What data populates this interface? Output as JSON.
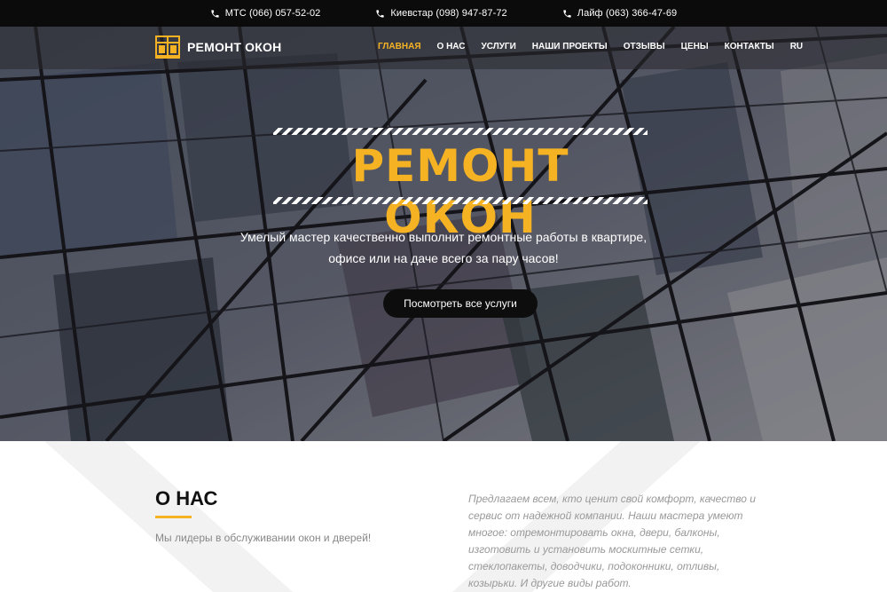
{
  "topbar": {
    "phones": [
      {
        "label": "МТС (066) 057-52-02"
      },
      {
        "label": "Киевстар (098) 947-87-72"
      },
      {
        "label": "Лайф (063) 366-47-69"
      }
    ]
  },
  "header": {
    "logo_text": "РЕМОНТ ОКОН",
    "menu": [
      {
        "label": "ГЛАВНАЯ",
        "active": true
      },
      {
        "label": "О НАС"
      },
      {
        "label": "УСЛУГИ"
      },
      {
        "label": "НАШИ ПРОЕКТЫ"
      },
      {
        "label": "ОТЗЫВЫ"
      },
      {
        "label": "ЦЕНЫ"
      },
      {
        "label": "КОНТАКТЫ"
      },
      {
        "label": "RU"
      }
    ]
  },
  "hero": {
    "title": "РЕМОНТ ОКОН",
    "subtitle_line1": "Умелый мастер качественно выполнит ремонтные работы в квартире,",
    "subtitle_line2": "офисе или на даче всего за пару часов!",
    "button_label": "Посмотреть все услуги"
  },
  "about": {
    "title": "О НАС",
    "lead": "Мы лидеры в обслуживании окон и дверей!",
    "text": "Предлагаем всем, кто ценит свой комфорт, качество и сервис от надежной компании. Наши мастера умеют многое: отремонтировать окна, двери, балконы, изготовить и установить москитные сетки, стеклопакеты, доводчики, подоконники, отливы, козырьки. И другие виды работ."
  },
  "colors": {
    "accent": "#f5b324",
    "topbar_bg": "#0b0b0b",
    "button_bg": "#0d0d0d"
  },
  "icons": {
    "phone": "phone-icon",
    "logo": "window-icon"
  }
}
